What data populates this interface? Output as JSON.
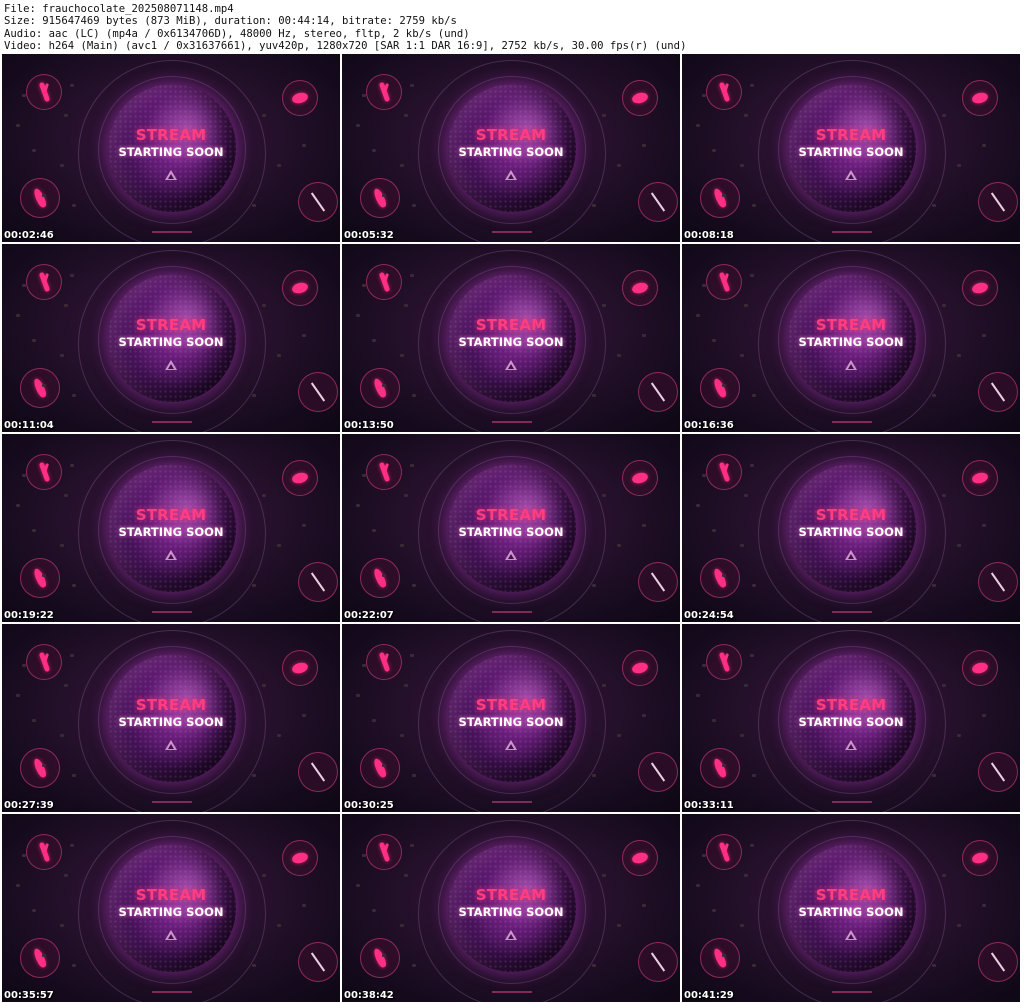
{
  "header": {
    "file_line": "File: frauchocolate_202508071148.mp4",
    "size_line": "Size: 915647469 bytes (873 MiB), duration: 00:44:14, bitrate: 2759 kb/s",
    "audio_line": "Audio: aac (LC) (mp4a / 0x6134706D), 48000 Hz, stereo, fltp, 2 kb/s (und)",
    "video_line": "Video: h264 (Main) (avc1 / 0x31637661), yuv420p, 1280x720 [SAR 1:1 DAR 16:9], 2752 kb/s, 30.00 fps(r) (und)"
  },
  "frame_text": {
    "stream": "STREAM",
    "starting_soon": "STARTING SOON"
  },
  "colors": {
    "accent_pink": "#ff2f86",
    "stream_text": "#ff3d7f",
    "background_dark": "#140a1c"
  },
  "thumbnails": [
    {
      "timestamp": "00:02:46"
    },
    {
      "timestamp": "00:05:32"
    },
    {
      "timestamp": "00:08:18"
    },
    {
      "timestamp": "00:11:04"
    },
    {
      "timestamp": "00:13:50"
    },
    {
      "timestamp": "00:16:36"
    },
    {
      "timestamp": "00:19:22"
    },
    {
      "timestamp": "00:22:07"
    },
    {
      "timestamp": "00:24:54"
    },
    {
      "timestamp": "00:27:39"
    },
    {
      "timestamp": "00:30:25"
    },
    {
      "timestamp": "00:33:11"
    },
    {
      "timestamp": "00:35:57"
    },
    {
      "timestamp": "00:38:42"
    },
    {
      "timestamp": "00:41:29"
    }
  ]
}
